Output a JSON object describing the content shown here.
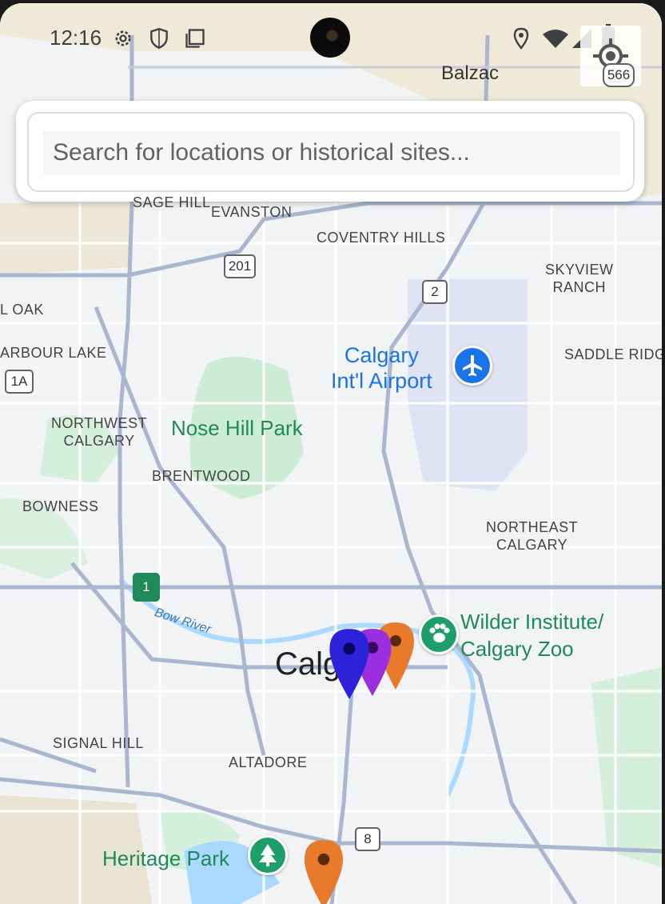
{
  "status_bar": {
    "time": "12:16"
  },
  "search": {
    "placeholder": "Search for locations or historical sites..."
  },
  "map": {
    "place_labels": {
      "balzac": "Balzac",
      "sage_hill": "SAGE HILL",
      "evanston": "EVANSTON",
      "coventry_hills": "COVENTRY HILLS",
      "skyview_ranch": "SKYVIEW\nRANCH",
      "royal_oak": "L OAK",
      "arbour_lake": "ARBOUR LAKE",
      "saddle_ridge": "SADDLE RIDGE",
      "northwest_calgary": "NORTHWEST\nCALGARY",
      "brentwood": "BRENTWOOD",
      "bowness": "BOWNESS",
      "northeast_calgary": "NORTHEAST\nCALGARY",
      "signal_hill": "SIGNAL HILL",
      "altadore": "ALTADORE",
      "calgary": "Calg"
    },
    "pois": {
      "airport": "Calgary\nInt'l Airport",
      "nose_hill_park": "Nose Hill Park",
      "zoo": "Wilder Institute/\nCalgary Zoo",
      "heritage_park": "Heritage Park",
      "bow_river": "Bow River"
    },
    "highways": {
      "hwy_566": "566",
      "hwy_201": "201",
      "hwy_2": "2",
      "hwy_1a": "1A",
      "hwy_1": "1",
      "hwy_8": "8"
    },
    "marker_colors": {
      "blue": "#2b22d9",
      "purple": "#9b2fe0",
      "orange": "#e87a2c"
    }
  }
}
